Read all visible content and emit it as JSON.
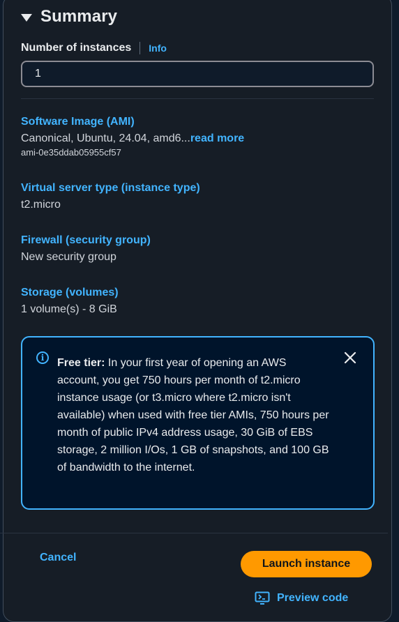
{
  "summary": {
    "title": "Summary",
    "instances": {
      "label": "Number of instances",
      "info_link": "Info",
      "value": "1"
    },
    "sections": {
      "ami": {
        "title": "Software Image (AMI)",
        "value": "Canonical, Ubuntu, 24.04, amd6...",
        "read_more": "read more",
        "sub": "ami-0e35ddab05955cf57"
      },
      "instance_type": {
        "title": "Virtual server type (instance type)",
        "value": "t2.micro"
      },
      "firewall": {
        "title": "Firewall (security group)",
        "value": "New security group"
      },
      "storage": {
        "title": "Storage (volumes)",
        "value": "1 volume(s) - 8 GiB"
      }
    },
    "free_tier_alert": {
      "heading": "Free tier:",
      "body": "In your first year of opening an AWS account, you get 750 hours per month of t2.micro instance usage (or t3.micro where t2.micro isn't available) when used with free tier AMIs, 750 hours per month of public IPv4 address usage, 30 GiB of EBS storage, 2 million I/Os, 1 GB of snapshots, and 100 GB of bandwidth to the internet.",
      "icon": "info-icon",
      "close_icon": "close-icon"
    },
    "actions": {
      "cancel_label": "Cancel",
      "launch_label": "Launch instance",
      "preview_label": "Preview code",
      "preview_icon": "code-preview-icon"
    }
  },
  "colors": {
    "accent": "#42b4ff",
    "primary_button": "#ff9900",
    "background": "#161d26"
  }
}
